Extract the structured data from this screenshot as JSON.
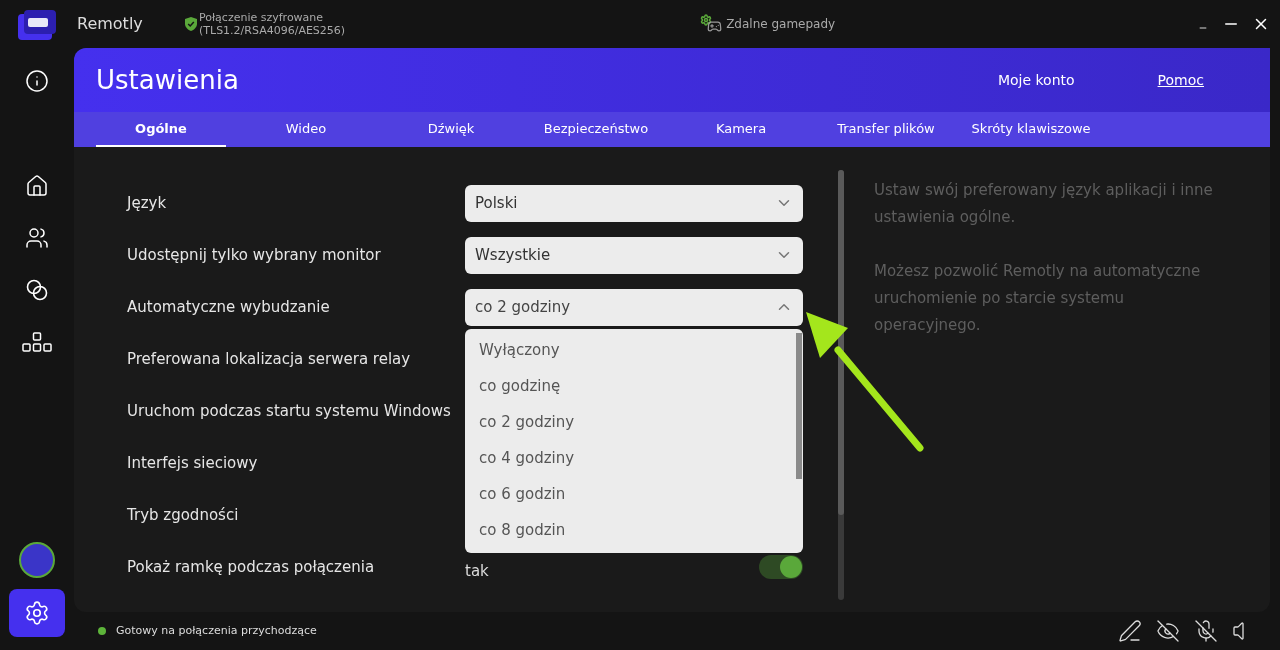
{
  "app": {
    "name": "Remotly"
  },
  "connection": {
    "line_1": "Połączenie szyfrowane",
    "line_2": "(TLS1.2/RSA4096/AES256)"
  },
  "gamepads": {
    "label": "Zdalne gamepady"
  },
  "sidebar": {
    "items": [
      {
        "selected": false
      },
      {
        "selected": false
      },
      {
        "selected": false
      },
      {
        "selected": false
      },
      {
        "selected": true
      }
    ]
  },
  "header": {
    "title": "Ustawienia",
    "links": [
      "Moje konto",
      "Pomoc"
    ]
  },
  "tabs": [
    {
      "label": "Ogólne",
      "selected": true
    },
    {
      "label": "Wideo",
      "selected": false
    },
    {
      "label": "Dźwięk",
      "selected": false
    },
    {
      "label": "Bezpieczeństwo",
      "selected": false
    },
    {
      "label": "Kamera",
      "selected": false
    },
    {
      "label": "Transfer plików",
      "selected": false
    },
    {
      "label": "Skróty klawiszowe",
      "selected": false
    }
  ],
  "settings": [
    {
      "label": "Język",
      "kind": "select",
      "value": "Polski",
      "expanded": false
    },
    {
      "label": "Udostępnij tylko wybrany monitor",
      "kind": "select",
      "value": "Wszystkie",
      "expanded": false
    },
    {
      "label": "Automatyczne wybudzanie",
      "kind": "select",
      "value": "co 2 godziny",
      "expanded": true,
      "options": [
        "Wyłączony",
        "co godzinę",
        "co 2 godziny",
        "co 4 godziny",
        "co 6 godzin",
        "co 8 godzin"
      ]
    },
    {
      "label": "Preferowana lokalizacja serwera relay",
      "kind": "hidden"
    },
    {
      "label": "Uruchom podczas startu systemu Windows",
      "kind": "hidden"
    },
    {
      "label": "Interfejs sieciowy",
      "kind": "hidden"
    },
    {
      "label": "Tryb zgodności",
      "kind": "hidden"
    },
    {
      "label": "Pokaż ramkę podczas połączenia",
      "kind": "toggle",
      "value": "tak",
      "on": true
    }
  ],
  "description": [
    "Ustaw swój preferowany język aplikacji i inne ustawienia ogólne.",
    "Możesz pozwolić Remotly na automatyczne uruchomienie po starcie systemu operacyjnego."
  ],
  "status_bar": {
    "text": "Gotowy na połączenia przychodzące",
    "color": "#5db43a"
  }
}
